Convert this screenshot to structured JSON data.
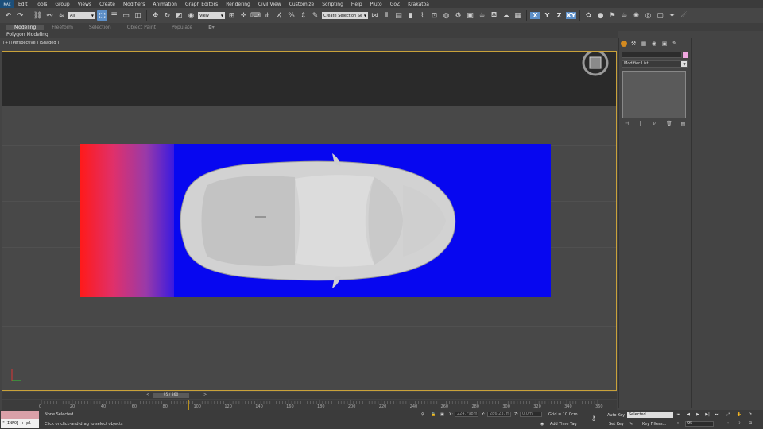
{
  "app": {
    "logo": "MAX"
  },
  "menu": [
    "Edit",
    "Tools",
    "Group",
    "Views",
    "Create",
    "Modifiers",
    "Animation",
    "Graph Editors",
    "Rendering",
    "Civil View",
    "Customize",
    "Scripting",
    "Help",
    "Pluto",
    "GoZ",
    "Krakatoa"
  ],
  "toolbar": {
    "filter_value": "All",
    "coord_system": "View",
    "selection_set": "Create Selection Se",
    "axes": [
      "X",
      "Y",
      "Z",
      "XY"
    ]
  },
  "ribbon": {
    "tabs": [
      "Modeling",
      "Freeform",
      "Selection",
      "Object Paint",
      "Populate"
    ],
    "active_tab": "Modeling",
    "panel_label": "Polygon Modeling"
  },
  "viewport": {
    "label": "[+] [Perspective ] [Shaded ]"
  },
  "timeline": {
    "slider_text": "95 / 360",
    "prev_label": "<",
    "next_label": ">",
    "current_frame": 95,
    "total_frames": 360,
    "tick_labels": [
      "0",
      "20",
      "40",
      "60",
      "80",
      "100",
      "120",
      "140",
      "160",
      "180",
      "200",
      "220",
      "240",
      "260",
      "280",
      "300",
      "320",
      "340",
      "360"
    ]
  },
  "statusbar": {
    "maxscript_output": "\"[INFO] : pl",
    "selection_status": "None Selected",
    "prompt": "Click or click-and-drag to select objects",
    "x_label": "X:",
    "x_value": "224.798m",
    "y_label": "Y:",
    "y_value": "286.237m",
    "z_label": "Z:",
    "z_value": "0.0m",
    "grid": "Grid = 10.0cm",
    "add_time_tag": "Add Time Tag",
    "auto_key": "Auto Key",
    "set_key": "Set Key",
    "key_filter": "Selected",
    "key_filters_btn": "Key Filters...",
    "frame_field": "95"
  },
  "command_panel": {
    "modifier_list": "Modifier List"
  },
  "colors": {
    "accent": "#5d8fc7",
    "backplate": "#0707f0",
    "gradient_start": "#ff1a1a",
    "viewport_border": "#c9a23a",
    "key_marker": "#b8901e"
  }
}
